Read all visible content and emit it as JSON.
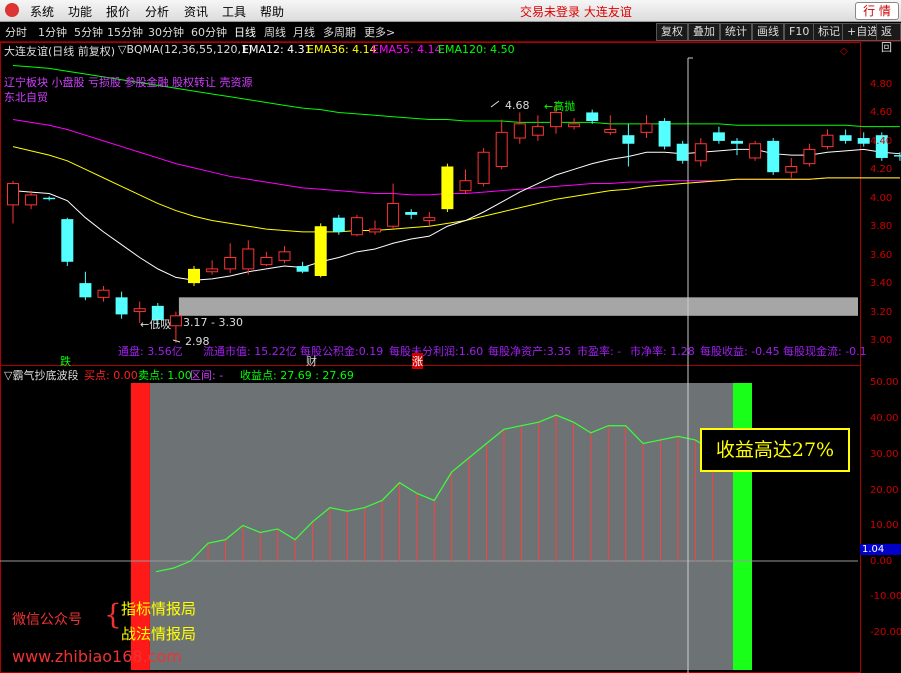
{
  "menubar": {
    "items": [
      "系统",
      "功能",
      "报价",
      "分析",
      "资讯",
      "工具",
      "帮助"
    ],
    "notice": "交易未登录  大连友谊",
    "quote_button": "行 情"
  },
  "tabs": {
    "periods": [
      "分时",
      "1分钟",
      "5分钟",
      "15分钟",
      "30分钟",
      "60分钟",
      "日线",
      "周线",
      "月线",
      "多周期",
      "更多>"
    ],
    "active": "日线",
    "buttons": [
      "复权",
      "叠加",
      "统计",
      "画线",
      "F10",
      "标记",
      "+自选",
      "返回"
    ]
  },
  "main_legend": {
    "title": "大连友谊(日线 前复权)",
    "indicator": "▽BQMA(12,36,55,120,1)",
    "ema12": "EMA12: 4.31",
    "ema36": "EMA36: 4.14",
    "ema55": "EMA55: 4.14",
    "ema120": "EMA120: 4.50",
    "sectors": "辽宁板块 小盘股 亏损股 参股金融 股权转让 壳资源",
    "sector2": "东北自贸",
    "colors": {
      "ema12": "#ffffff",
      "ema36": "#ffff00",
      "ema55": "#ff00ff",
      "ema120": "#00ff00"
    }
  },
  "annotations": {
    "high": "4.68",
    "high_tag": "←高抛",
    "low": "2.98",
    "low_tag": "←低吸",
    "range": "3.17 - 3.30"
  },
  "fin": {
    "f1": "通盘: 3.56亿",
    "f2": "流通市值: 15.22亿",
    "f3": "每股公积金:0.19",
    "f4": "每股未分利润:1.60",
    "f5": "每股净资产:3.35",
    "f6": "市盈率: -",
    "f7": "市净率: 1.28",
    "f8": "每股收益: -0.45",
    "f9": "每股现金流: -0.1"
  },
  "markers": {
    "m1": "跌",
    "m2": "财",
    "m3": "涨"
  },
  "main_axis": [
    "4.80",
    "4.60",
    "4.40",
    "4.20",
    "4.00",
    "3.80",
    "3.60",
    "3.40",
    "3.20",
    "3.00"
  ],
  "sub_legend": {
    "name": "▽霸气抄底波段",
    "buy": "买点: 0.00",
    "sell": "卖点: 1.00",
    "range": "区间: -",
    "profit": "收益点: 27.69 : 27.69"
  },
  "sub_axis": [
    "50.00",
    "40.00",
    "30.00",
    "20.00",
    "10.00",
    "0.00",
    "-10.00",
    "-20.00"
  ],
  "sub_current": "1.04",
  "profit_box": "收益高达27%",
  "watermark": {
    "wechat": "微信公众号",
    "name1": "指标情报局",
    "name2": "战法情报局",
    "url": "www.zhibiao168.com"
  },
  "chart_data": {
    "type": "candlestick",
    "ylim": [
      2.95,
      4.95
    ],
    "candles": [
      {
        "o": 3.95,
        "c": 4.1,
        "h": 4.12,
        "l": 3.82
      },
      {
        "o": 3.95,
        "c": 4.02,
        "h": 4.05,
        "l": 3.92
      },
      {
        "o": 4.0,
        "c": 3.99,
        "h": 4.01,
        "l": 3.98
      },
      {
        "o": 3.85,
        "c": 3.55,
        "h": 3.86,
        "l": 3.52
      },
      {
        "o": 3.4,
        "c": 3.3,
        "h": 3.48,
        "l": 3.28
      },
      {
        "o": 3.3,
        "c": 3.35,
        "h": 3.38,
        "l": 3.27
      },
      {
        "o": 3.3,
        "c": 3.18,
        "h": 3.34,
        "l": 3.15
      },
      {
        "o": 3.2,
        "c": 3.22,
        "h": 3.27,
        "l": 3.12
      },
      {
        "o": 3.24,
        "c": 3.14,
        "h": 3.26,
        "l": 3.1
      },
      {
        "o": 3.1,
        "c": 3.17,
        "h": 3.2,
        "l": 2.98
      },
      {
        "o": 3.4,
        "c": 3.5,
        "h": 3.52,
        "l": 3.38
      },
      {
        "o": 3.48,
        "c": 3.5,
        "h": 3.56,
        "l": 3.46
      },
      {
        "o": 3.5,
        "c": 3.58,
        "h": 3.68,
        "l": 3.47
      },
      {
        "o": 3.5,
        "c": 3.64,
        "h": 3.7,
        "l": 3.46
      },
      {
        "o": 3.53,
        "c": 3.58,
        "h": 3.62,
        "l": 3.52
      },
      {
        "o": 3.56,
        "c": 3.62,
        "h": 3.66,
        "l": 3.54
      },
      {
        "o": 3.52,
        "c": 3.48,
        "h": 3.55,
        "l": 3.47
      },
      {
        "o": 3.45,
        "c": 3.8,
        "h": 3.82,
        "l": 3.44
      },
      {
        "o": 3.86,
        "c": 3.76,
        "h": 3.88,
        "l": 3.74
      },
      {
        "o": 3.74,
        "c": 3.86,
        "h": 3.88,
        "l": 3.73
      },
      {
        "o": 3.76,
        "c": 3.78,
        "h": 3.84,
        "l": 3.74
      },
      {
        "o": 3.8,
        "c": 3.96,
        "h": 4.1,
        "l": 3.78
      },
      {
        "o": 3.9,
        "c": 3.88,
        "h": 3.92,
        "l": 3.85
      },
      {
        "o": 3.84,
        "c": 3.86,
        "h": 3.9,
        "l": 3.8
      },
      {
        "o": 3.92,
        "c": 4.22,
        "h": 4.24,
        "l": 3.9
      },
      {
        "o": 4.05,
        "c": 4.12,
        "h": 4.2,
        "l": 4.03
      },
      {
        "o": 4.1,
        "c": 4.32,
        "h": 4.35,
        "l": 4.08
      },
      {
        "o": 4.22,
        "c": 4.46,
        "h": 4.55,
        "l": 4.2
      },
      {
        "o": 4.42,
        "c": 4.52,
        "h": 4.6,
        "l": 4.38
      },
      {
        "o": 4.44,
        "c": 4.5,
        "h": 4.58,
        "l": 4.4
      },
      {
        "o": 4.5,
        "c": 4.6,
        "h": 4.68,
        "l": 4.45
      },
      {
        "o": 4.5,
        "c": 4.52,
        "h": 4.56,
        "l": 4.48
      },
      {
        "o": 4.6,
        "c": 4.54,
        "h": 4.62,
        "l": 4.52
      },
      {
        "o": 4.46,
        "c": 4.48,
        "h": 4.58,
        "l": 4.44
      },
      {
        "o": 4.44,
        "c": 4.38,
        "h": 4.52,
        "l": 4.22
      },
      {
        "o": 4.46,
        "c": 4.52,
        "h": 4.58,
        "l": 4.42
      },
      {
        "o": 4.54,
        "c": 4.36,
        "h": 4.56,
        "l": 4.34
      },
      {
        "o": 4.38,
        "c": 4.26,
        "h": 4.4,
        "l": 4.24
      },
      {
        "o": 4.26,
        "c": 4.38,
        "h": 4.42,
        "l": 4.22
      },
      {
        "o": 4.46,
        "c": 4.4,
        "h": 4.5,
        "l": 4.38
      },
      {
        "o": 4.4,
        "c": 4.38,
        "h": 4.42,
        "l": 4.3
      },
      {
        "o": 4.28,
        "c": 4.38,
        "h": 4.4,
        "l": 4.26
      },
      {
        "o": 4.4,
        "c": 4.18,
        "h": 4.42,
        "l": 4.16
      },
      {
        "o": 4.18,
        "c": 4.22,
        "h": 4.28,
        "l": 4.14
      },
      {
        "o": 4.24,
        "c": 4.34,
        "h": 4.38,
        "l": 4.22
      },
      {
        "o": 4.36,
        "c": 4.44,
        "h": 4.48,
        "l": 4.34
      },
      {
        "o": 4.44,
        "c": 4.4,
        "h": 4.48,
        "l": 4.38
      },
      {
        "o": 4.42,
        "c": 4.38,
        "h": 4.46,
        "l": 4.36
      },
      {
        "o": 4.44,
        "c": 4.28,
        "h": 4.46,
        "l": 4.26
      },
      {
        "o": 4.3,
        "c": 4.29,
        "h": 4.32,
        "l": 4.26
      }
    ],
    "ema12": [
      4.05,
      4.04,
      4.03,
      3.98,
      3.86,
      3.76,
      3.67,
      3.58,
      3.5,
      3.44,
      3.42,
      3.43,
      3.45,
      3.48,
      3.5,
      3.52,
      3.51,
      3.55,
      3.58,
      3.62,
      3.64,
      3.68,
      3.71,
      3.73,
      3.8,
      3.84,
      3.9,
      3.97,
      4.04,
      4.1,
      4.16,
      4.2,
      4.24,
      4.27,
      4.29,
      4.32,
      4.32,
      4.31,
      4.32,
      4.33,
      4.34,
      4.34,
      4.31,
      4.3,
      4.3,
      4.32,
      4.33,
      4.34,
      4.32,
      4.31
    ],
    "ema36": [
      4.36,
      4.33,
      4.3,
      4.26,
      4.2,
      4.14,
      4.08,
      4.02,
      3.96,
      3.91,
      3.87,
      3.84,
      3.82,
      3.8,
      3.78,
      3.77,
      3.76,
      3.76,
      3.76,
      3.77,
      3.77,
      3.78,
      3.79,
      3.8,
      3.82,
      3.84,
      3.87,
      3.9,
      3.93,
      3.96,
      3.99,
      4.01,
      4.03,
      4.05,
      4.06,
      4.08,
      4.09,
      4.1,
      4.11,
      4.12,
      4.13,
      4.13,
      4.13,
      4.13,
      4.13,
      4.14,
      4.14,
      4.14,
      4.14,
      4.14
    ],
    "ema55": [
      4.55,
      4.53,
      4.51,
      4.48,
      4.44,
      4.4,
      4.36,
      4.32,
      4.28,
      4.24,
      4.21,
      4.18,
      4.15,
      4.13,
      4.11,
      4.09,
      4.07,
      4.06,
      4.05,
      4.04,
      4.03,
      4.03,
      4.02,
      4.02,
      4.03,
      4.03,
      4.04,
      4.05,
      4.06,
      4.07,
      4.08,
      4.09,
      4.1,
      4.1,
      4.11,
      4.11,
      4.12,
      4.12,
      4.12,
      4.12,
      4.13,
      4.13,
      4.13,
      4.13,
      4.13,
      4.14,
      4.14,
      4.14,
      4.14,
      4.14
    ],
    "ema120": [
      4.93,
      4.92,
      4.91,
      4.89,
      4.87,
      4.85,
      4.83,
      4.81,
      4.79,
      4.77,
      4.75,
      4.73,
      4.71,
      4.69,
      4.67,
      4.65,
      4.63,
      4.62,
      4.6,
      4.59,
      4.58,
      4.57,
      4.56,
      4.55,
      4.55,
      4.54,
      4.54,
      4.54,
      4.53,
      4.53,
      4.53,
      4.53,
      4.53,
      4.52,
      4.52,
      4.52,
      4.52,
      4.52,
      4.52,
      4.52,
      4.51,
      4.51,
      4.51,
      4.51,
      4.51,
      4.51,
      4.51,
      4.5,
      4.5,
      4.5
    ],
    "band": {
      "from_index": 9,
      "low": 3.17,
      "high": 3.3
    },
    "sub": {
      "ylim": [
        -30,
        55
      ],
      "values": [
        -3,
        -2,
        0,
        5,
        6,
        10,
        8,
        9,
        6,
        11,
        15,
        14,
        15,
        17,
        22,
        19,
        17,
        25,
        29,
        33,
        37,
        38,
        39,
        41,
        39,
        36,
        38,
        38,
        33,
        34,
        35,
        34,
        31
      ],
      "start_index": 9,
      "buy_index": 9,
      "sell_index": 40
    }
  }
}
